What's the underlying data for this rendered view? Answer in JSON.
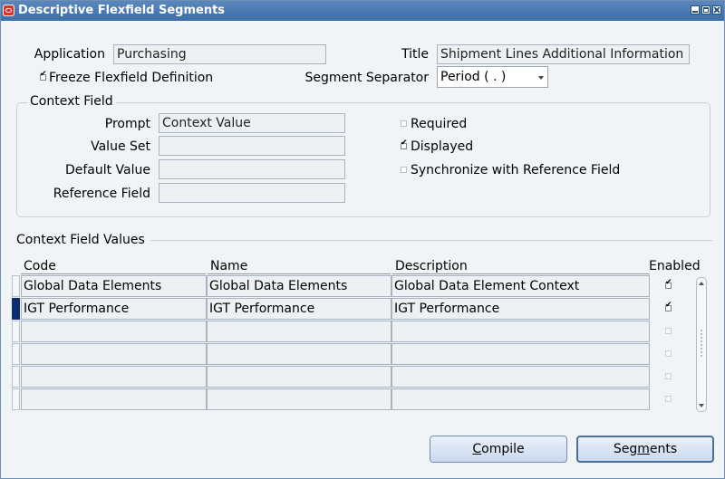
{
  "window": {
    "title": "Descriptive Flexfield Segments",
    "controls": [
      "minimize-icon",
      "maximize-icon",
      "close-icon"
    ]
  },
  "header": {
    "application_label": "Application",
    "application_value": "Purchasing",
    "title_label": "Title",
    "title_value": "Shipment Lines Additional Information",
    "freeze_label": "Freeze Flexfield Definition",
    "freeze_checked": true,
    "separator_label": "Segment Separator",
    "separator_value": "Period ( . )"
  },
  "context_field": {
    "group_title": "Context Field",
    "prompt_label": "Prompt",
    "prompt_value": "Context Value",
    "value_set_label": "Value Set",
    "value_set_value": "",
    "default_value_label": "Default Value",
    "default_value_value": "",
    "reference_field_label": "Reference Field",
    "reference_field_value": "",
    "required_label": "Required",
    "required_checked": false,
    "displayed_label": "Displayed",
    "displayed_checked": true,
    "sync_label": "Synchronize with Reference Field",
    "sync_checked": false
  },
  "values_table": {
    "section_title": "Context Field Values",
    "columns": {
      "code": "Code",
      "name": "Name",
      "description": "Description",
      "enabled": "Enabled"
    },
    "rows": [
      {
        "code": "Global Data Elements",
        "name": "Global Data Elements",
        "description": "Global Data Element Context",
        "enabled": true
      },
      {
        "code": "IGT Performance",
        "name": "IGT Performance",
        "description": "IGT Performance",
        "enabled": true
      },
      {
        "code": "",
        "name": "",
        "description": "",
        "enabled": false
      },
      {
        "code": "",
        "name": "",
        "description": "",
        "enabled": false
      },
      {
        "code": "",
        "name": "",
        "description": "",
        "enabled": false
      },
      {
        "code": "",
        "name": "",
        "description": "",
        "enabled": false
      }
    ],
    "active_row": 2
  },
  "buttons": {
    "compile_mnemonic": "C",
    "compile_rest": "ompile",
    "segments_pre": "Seg",
    "segments_mnemonic": "m",
    "segments_post": "ents"
  }
}
